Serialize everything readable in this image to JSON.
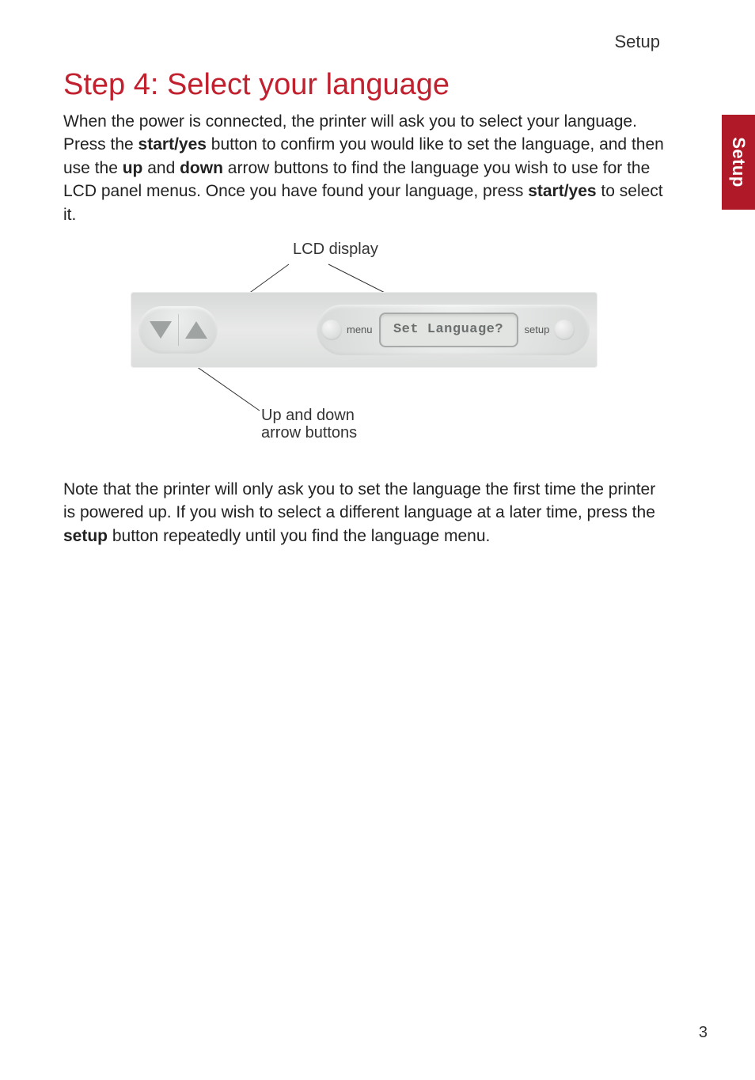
{
  "header": {
    "section": "Setup"
  },
  "sideTab": "Setup",
  "title": "Step 4: Select your language",
  "para1": {
    "t1": "When the power is connected, the printer will ask you to select your language. Press the ",
    "b1": "start/yes",
    "t2": " button to confirm you would like to set the language, and then use the ",
    "b2": "up",
    "t3": " and ",
    "b3": "down",
    "t4": " arrow buttons to find the language you wish to use for the LCD panel menus. Once you have found your language, press ",
    "b4": "start/yes",
    "t5": " to select it."
  },
  "diagram": {
    "lcdLabel": "LCD display",
    "arrowLabelLine1": "Up and down",
    "arrowLabelLine2": "arrow buttons",
    "menuLabel": "menu",
    "setupLabel": "setup",
    "lcdText": "Set Language?"
  },
  "para2": {
    "t1": "Note that the printer will only ask you to set the language the first time the printer is powered up. If you wish to select a different language at a later time, press the ",
    "b1": "setup",
    "t2": " button repeatedly until you find the language menu."
  },
  "pageNumber": "3"
}
